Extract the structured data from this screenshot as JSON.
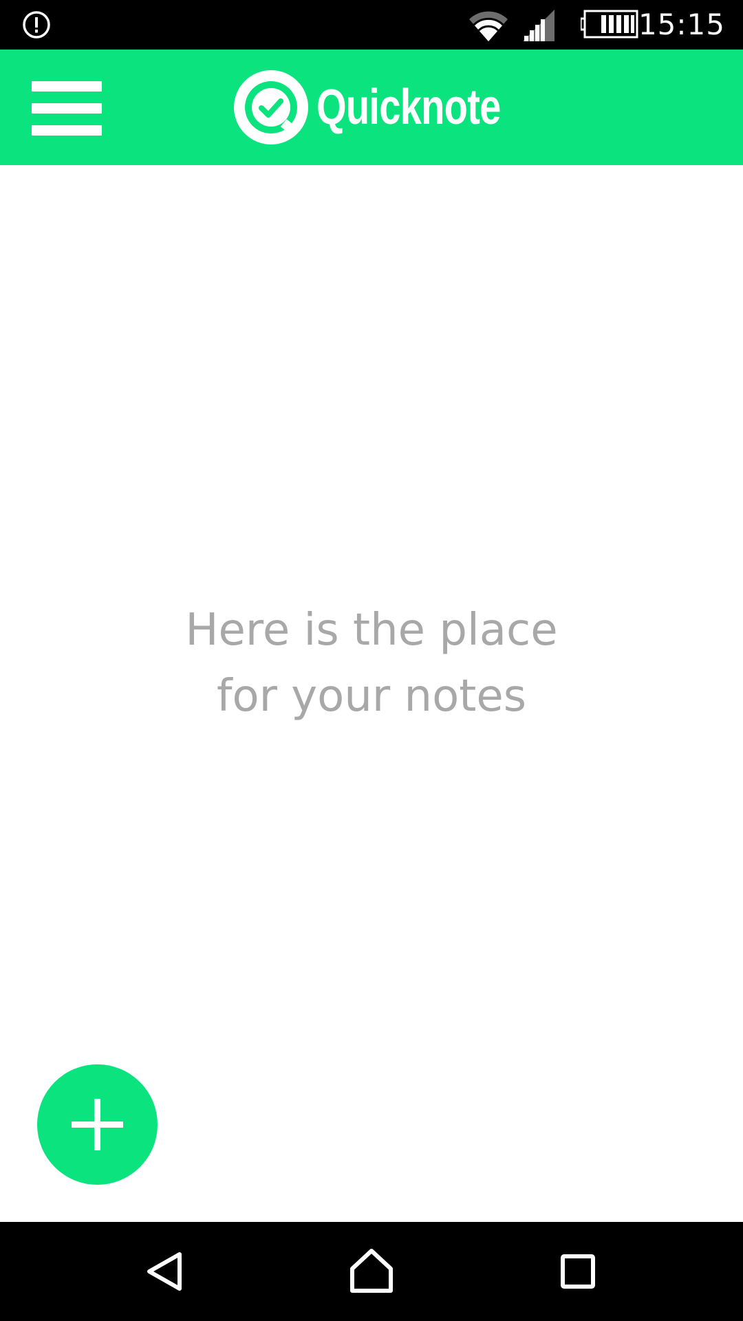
{
  "status_bar": {
    "time": "15:15",
    "icons": [
      "alert-icon",
      "wifi-icon",
      "cellular-signal-icon",
      "battery-icon"
    ]
  },
  "app_bar": {
    "title": "Quicknote",
    "menu_icon": "hamburger-menu-icon",
    "logo_icon": "quicknote-logo-check-icon",
    "background_color": "#0be37e"
  },
  "empty_state": {
    "line1": "Here is the place",
    "line2": "for your notes",
    "text_color": "#a8a8a8"
  },
  "fab": {
    "icon": "plus-icon",
    "color": "#0be37e"
  },
  "nav_bar": {
    "icons": [
      "back-icon",
      "home-icon",
      "recents-icon"
    ]
  }
}
